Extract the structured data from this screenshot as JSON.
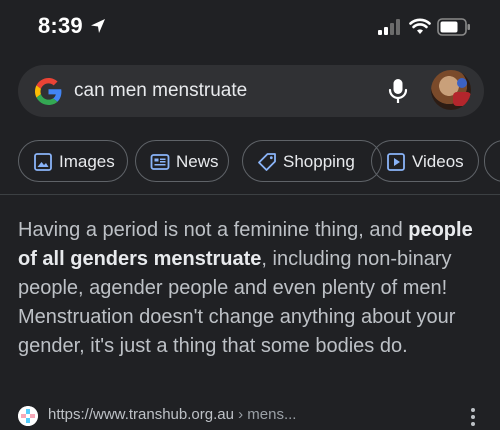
{
  "status_bar": {
    "time": "8:39",
    "icons": [
      "location-arrow-icon",
      "cellular-signal-icon",
      "wifi-icon",
      "battery-icon"
    ]
  },
  "search": {
    "query": "can men menstruate",
    "icons": [
      "google-g-logo",
      "microphone-icon",
      "avatar"
    ]
  },
  "chips": [
    {
      "label": "Images",
      "icon": "images-icon"
    },
    {
      "label": "News",
      "icon": "news-icon"
    },
    {
      "label": "Shopping",
      "icon": "shopping-tag-icon"
    },
    {
      "label": "Videos",
      "icon": "videos-icon"
    }
  ],
  "snippet": {
    "text_before": "Having a period is not a feminine thing, and ",
    "bold": "people of all genders menstruate",
    "text_after": ", including non-binary people, agender people and even plenty of men! Menstruation doesn't change anything about your gender, it's just a thing that some bodies do."
  },
  "source": {
    "url": "https://www.transhub.org.au",
    "path": " › mens..."
  },
  "colors": {
    "background": "#202124",
    "search_bar": "#303134",
    "chip_border": "#5f6368",
    "text_primary": "#e8eaed",
    "text_secondary": "#bdc1c6"
  }
}
